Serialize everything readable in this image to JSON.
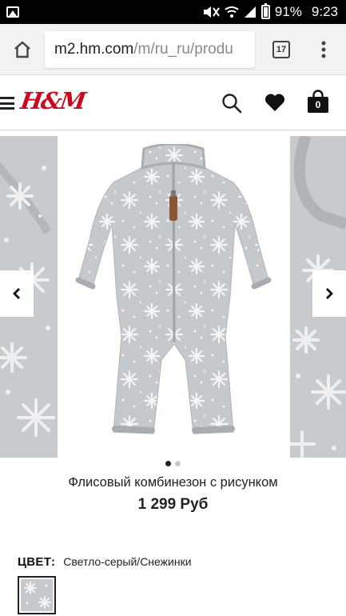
{
  "statusbar": {
    "battery": "91%",
    "time": "9:23",
    "icons": [
      "image-notification-icon",
      "mute-icon",
      "wifi-icon",
      "signal-icon",
      "battery-icon"
    ]
  },
  "browser": {
    "url_host": "m2.hm.com",
    "url_path": "/m/ru_ru/produ",
    "tab_count": "17"
  },
  "site": {
    "logo": "H&M",
    "bag_count": "0"
  },
  "product": {
    "title": "Флисовый комбинезон с рисунком",
    "price": "1 299 Руб",
    "image_count": 2,
    "active_image": 0,
    "color_label": "ЦВЕТ:",
    "color_value": "Светло-серый/Снежинки"
  },
  "colors": {
    "brand_red": "#cc071e",
    "garment_grey": "#c4c7ca",
    "trim_grey": "#a9adb1"
  }
}
